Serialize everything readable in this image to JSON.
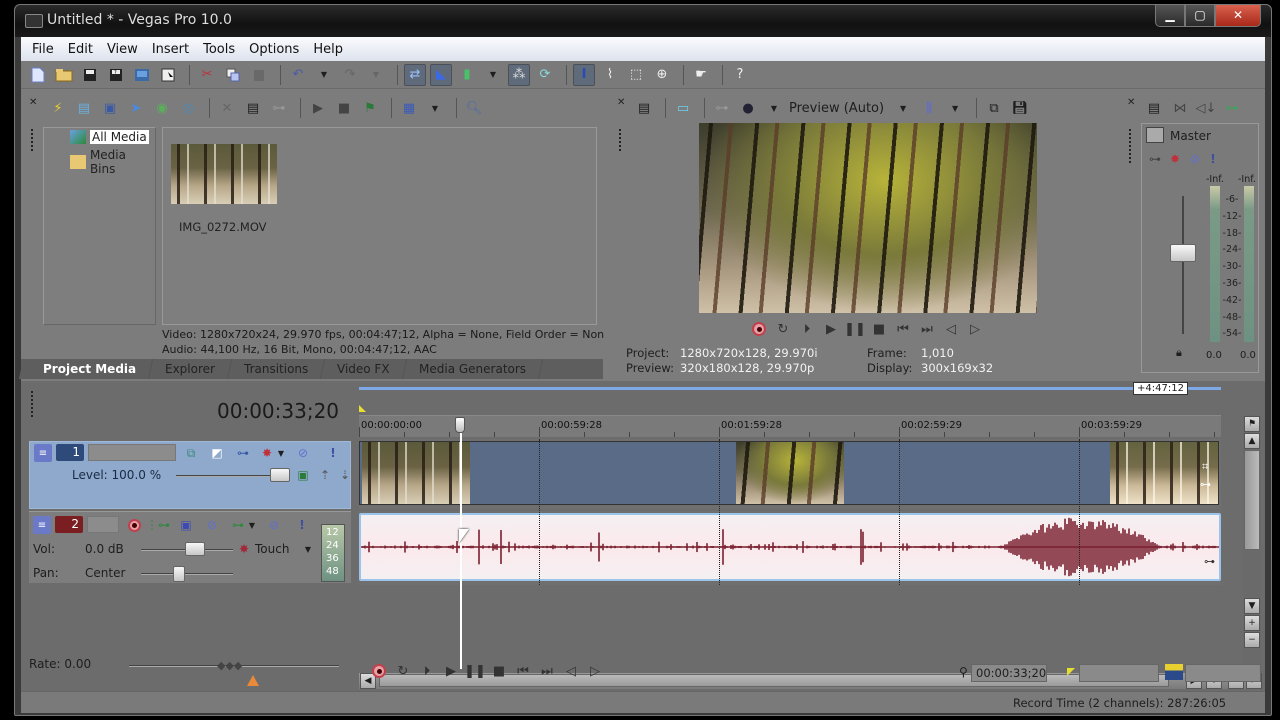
{
  "window": {
    "title": "Untitled * - Vegas Pro 10.0",
    "controls": {
      "minimize": "▁",
      "maximize": "▢",
      "close": "✕"
    }
  },
  "menu": [
    "File",
    "Edit",
    "View",
    "Insert",
    "Tools",
    "Options",
    "Help"
  ],
  "main_toolbar": {
    "icons": [
      "new-file",
      "open-folder",
      "save",
      "save-as",
      "render-as",
      "properties",
      "cut",
      "copy",
      "paste",
      "undo",
      "undo-dropdown",
      "redo",
      "redo-dropdown",
      "auto-ripple",
      "lock-envelopes",
      "ignore-grouping",
      "ignore-dropdown",
      "auto-crossfade",
      "snapping",
      "normal-edit-tool",
      "envelope-tool",
      "selection-tool",
      "zoom-tool",
      "enable-snapping",
      "whats-this-help"
    ]
  },
  "project_media": {
    "tree": [
      {
        "label": "All Media",
        "selected": true
      },
      {
        "label": "Media Bins",
        "selected": false
      }
    ],
    "items": [
      {
        "name": "IMG_0272.MOV"
      }
    ],
    "video_info": "Video: 1280x720x24, 29.970 fps, 00:04:47;12, Alpha = None, Field Order = Non",
    "audio_info": "Audio: 44,100 Hz, 16 Bit, Mono, 00:04:47;12, AAC",
    "tabs": [
      {
        "label": "Project Media",
        "active": true
      },
      {
        "label": "Explorer",
        "active": false
      },
      {
        "label": "Transitions",
        "active": false
      },
      {
        "label": "Video FX",
        "active": false
      },
      {
        "label": "Media Generators",
        "active": false
      }
    ]
  },
  "preview": {
    "quality": "Preview (Auto)",
    "project_label": "Project:",
    "project_value": "1280x720x128, 29.970i",
    "preview_label": "Preview:",
    "preview_value": "320x180x128, 29.970p",
    "frame_label": "Frame:",
    "frame_value": "1,010",
    "display_label": "Display:",
    "display_value": "300x169x32"
  },
  "mixer": {
    "title": "Master",
    "peak_left": "-Inf.",
    "peak_right": "-Inf.",
    "scale": [
      "6",
      "12",
      "18",
      "24",
      "30",
      "36",
      "42",
      "48",
      "54"
    ],
    "value_left": "0.0",
    "value_right": "0.0"
  },
  "timeline": {
    "timecode": "00:00:33;20",
    "duration_badge": "+4:47:12",
    "ruler_labels": [
      "00:00:00:00",
      "00:00:59:28",
      "00:01:59:28",
      "00:02:59:29",
      "00:03:59:29"
    ],
    "video_track": {
      "number": "1",
      "level_label": "Level: 100.0 %",
      "level_percent": 100
    },
    "audio_track": {
      "number": "2",
      "vol_label": "Vol:",
      "vol_value": "0.0 dB",
      "pan_label": "Pan:",
      "pan_value": "Center",
      "automation_mode": "Touch",
      "meter_scale": [
        "12",
        "24",
        "36",
        "48"
      ]
    },
    "rate_label": "Rate: 0.00"
  },
  "status": {
    "cursor_time": "00:00:33;20",
    "record_time": "Record Time (2 channels): 287:26:05"
  }
}
